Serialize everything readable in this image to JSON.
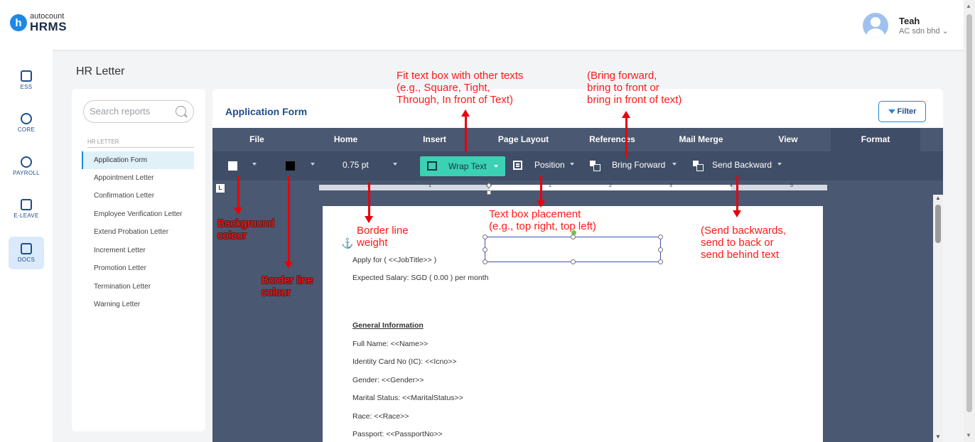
{
  "brand": {
    "small": "autocount",
    "big": "HRMS",
    "mark": "h"
  },
  "user": {
    "name": "Teah",
    "company": "AC sdn bhd"
  },
  "nav": [
    {
      "label": "ESS"
    },
    {
      "label": "CORE"
    },
    {
      "label": "PAYROLL"
    },
    {
      "label": "E-LEAVE"
    },
    {
      "label": "DOCS"
    }
  ],
  "page_title": "HR Letter",
  "search": {
    "placeholder": "Search reports"
  },
  "reports": {
    "section": "HR LETTER",
    "items": [
      "Application Form",
      "Appointment Letter",
      "Confirmation Letter",
      "Employee Verification Letter",
      "Extend Probation Letter",
      "Increment Letter",
      "Promotion Letter",
      "Termination Letter",
      "Warning Letter"
    ],
    "selected": "Application Form"
  },
  "main": {
    "title": "Application Form",
    "filter_label": "Filter"
  },
  "ribbon": {
    "tabs": [
      "File",
      "Home",
      "Insert",
      "Page Layout",
      "References",
      "Mail Merge",
      "View",
      "Format"
    ],
    "active_tab": "Format"
  },
  "toolbar": {
    "background_colour": "#ffffff",
    "border_colour": "#000000",
    "border_weight": "0.75 pt",
    "wrap_text": "Wrap Text",
    "position": "Position",
    "bring_forward": "Bring Forward",
    "send_backward": "Send Backward"
  },
  "ruler": {
    "numbers": [
      "2",
      "1",
      "1",
      "2",
      "3",
      "4",
      "5"
    ]
  },
  "document": {
    "lines": [
      "Apply for (  <<JobTitle>> )",
      "Expected Salary: SGD ( 0.00 ) per month",
      "General Information",
      "Full Name: <<Name>>",
      "Identity Card No (IC): <<Icno>>",
      "Gender: <<Gender>>",
      "Marital Status: <<MaritalStatus>>",
      "Race: <<Race>>",
      "Passport: <<PassportNo>>"
    ]
  },
  "annotations": {
    "wrap_text": [
      "Fit text box with other texts",
      "(e.g., Square, Tight,",
      "Through, In front of Text)"
    ],
    "bring_forward": [
      "(Bring forward,",
      "bring to front or",
      "bring in front of text)"
    ],
    "background_colour": [
      "Background",
      "colour"
    ],
    "border_weight": [
      "Border line",
      "weight"
    ],
    "border_colour": [
      "Border line",
      "colour"
    ],
    "position": [
      "Text box placement",
      "(e.g., top right, top left)"
    ],
    "send_backward": [
      "(Send backwards,",
      "send to back or",
      "send behind text"
    ]
  },
  "colors": {
    "accent": "#1e88e5",
    "ribbon": "#4a5871",
    "toolbar": "#3f4d66",
    "wrap_button": "#3ad1b5",
    "annotation": "#ff1a1a"
  }
}
